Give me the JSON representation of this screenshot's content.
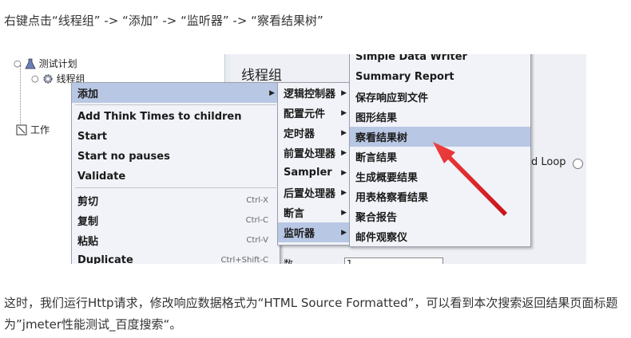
{
  "intro_text": "右键点击“线程组” -> “添加” -> “监听器” -> “察看结果树”",
  "outro_text": "这时，我们运行Http请求，修改响应数据格式为“HTML Source Formatted”，可以看到本次搜索返回结果页面标题为”jmeter性能测试_百度搜索“。",
  "tree": {
    "test_plan": "测试计划",
    "thread_group": "线程组",
    "workbench": "工作"
  },
  "panel": {
    "title": "线程组",
    "loop_label": "d Loop",
    "bottom_label": "数",
    "bottom_field": "1"
  },
  "context_menu": {
    "items": [
      {
        "label": "添加",
        "shortcut": ""
      },
      {
        "label": "Add Think Times to children",
        "shortcut": ""
      },
      {
        "label": "Start",
        "shortcut": ""
      },
      {
        "label": "Start no pauses",
        "shortcut": ""
      },
      {
        "label": "Validate",
        "shortcut": ""
      },
      {
        "label": "剪切",
        "shortcut": "Ctrl-X"
      },
      {
        "label": "复制",
        "shortcut": "Ctrl-C"
      },
      {
        "label": "粘贴",
        "shortcut": "Ctrl-V"
      },
      {
        "label": "Duplicate",
        "shortcut": "Ctrl+Shift-C"
      }
    ]
  },
  "add_submenu": {
    "items": [
      "逻辑控制器",
      "配置元件",
      "定时器",
      "前置处理器",
      "Sampler",
      "后置处理器",
      "断言",
      "监听器"
    ]
  },
  "listener_submenu": {
    "items": [
      "Simple Data Writer",
      "Summary Report",
      "保存响应到文件",
      "图形结果",
      "察看结果树",
      "断言结果",
      "生成概要结果",
      "用表格察看结果",
      "聚合报告",
      "邮件观察仪"
    ]
  },
  "colors": {
    "highlight": "#b8c7e3",
    "menu_bg": "#f1f3f8",
    "annotation_arrow": "#e8262a"
  }
}
